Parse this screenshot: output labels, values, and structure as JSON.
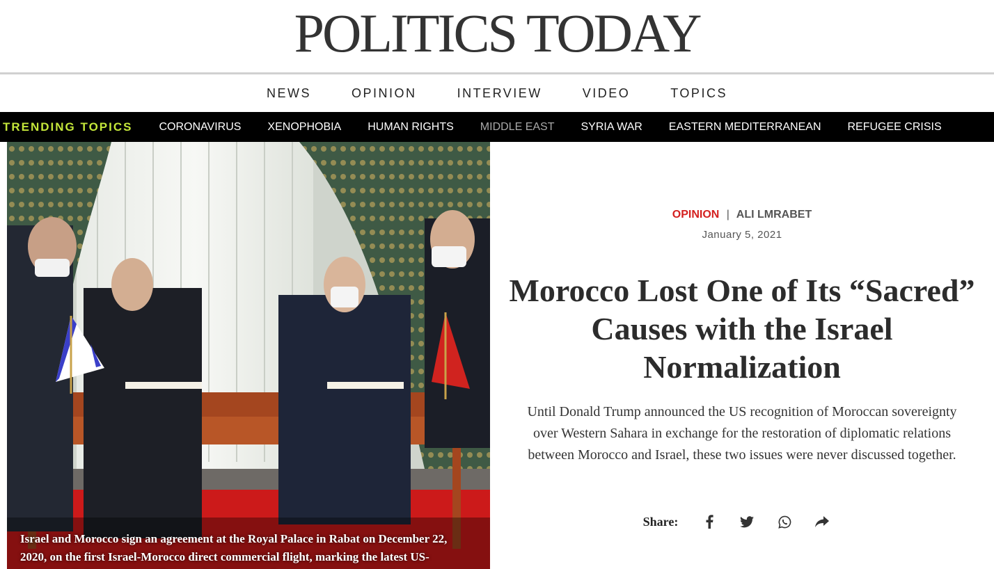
{
  "site": {
    "logo_text": "POLITICS TODAY"
  },
  "main_nav": {
    "items": [
      "NEWS",
      "OPINION",
      "INTERVIEW",
      "VIDEO",
      "TOPICS"
    ]
  },
  "trending": {
    "label": "TRENDING TOPICS",
    "items": [
      "CORONAVIRUS",
      "XENOPHOBIA",
      "HUMAN RIGHTS",
      "MIDDLE EAST",
      "SYRIA WAR",
      "EASTERN MEDITERRANEAN",
      "REFUGEE CRISIS"
    ]
  },
  "hero": {
    "caption": "Israel and Morocco sign an agreement at the Royal Palace in Rabat on December 22, 2020, on the first Israel-Morocco direct commercial flight, marking the latest US-brokered diplomatic normalization deal between the Jewish state and an Arab"
  },
  "article": {
    "category": "OPINION",
    "separator": "|",
    "author": "ALI LMRABET",
    "date": "January 5, 2021",
    "headline": "Morocco Lost One of Its “Sacred” Causes with the Israel Normalization",
    "dek": "Until Donald Trump announced the US recognition of Moroccan sovereignty over Western Sahara in exchange for the restoration of diplomatic relations between Morocco and Israel, these two issues were never discussed together."
  },
  "share": {
    "label": "Share:",
    "icons": [
      "facebook-icon",
      "twitter-icon",
      "whatsapp-icon",
      "share-arrow-icon"
    ]
  },
  "colors": {
    "accent_red": "#d4201f",
    "trending_label": "#c4e63a",
    "trending_bar": "#000000"
  }
}
